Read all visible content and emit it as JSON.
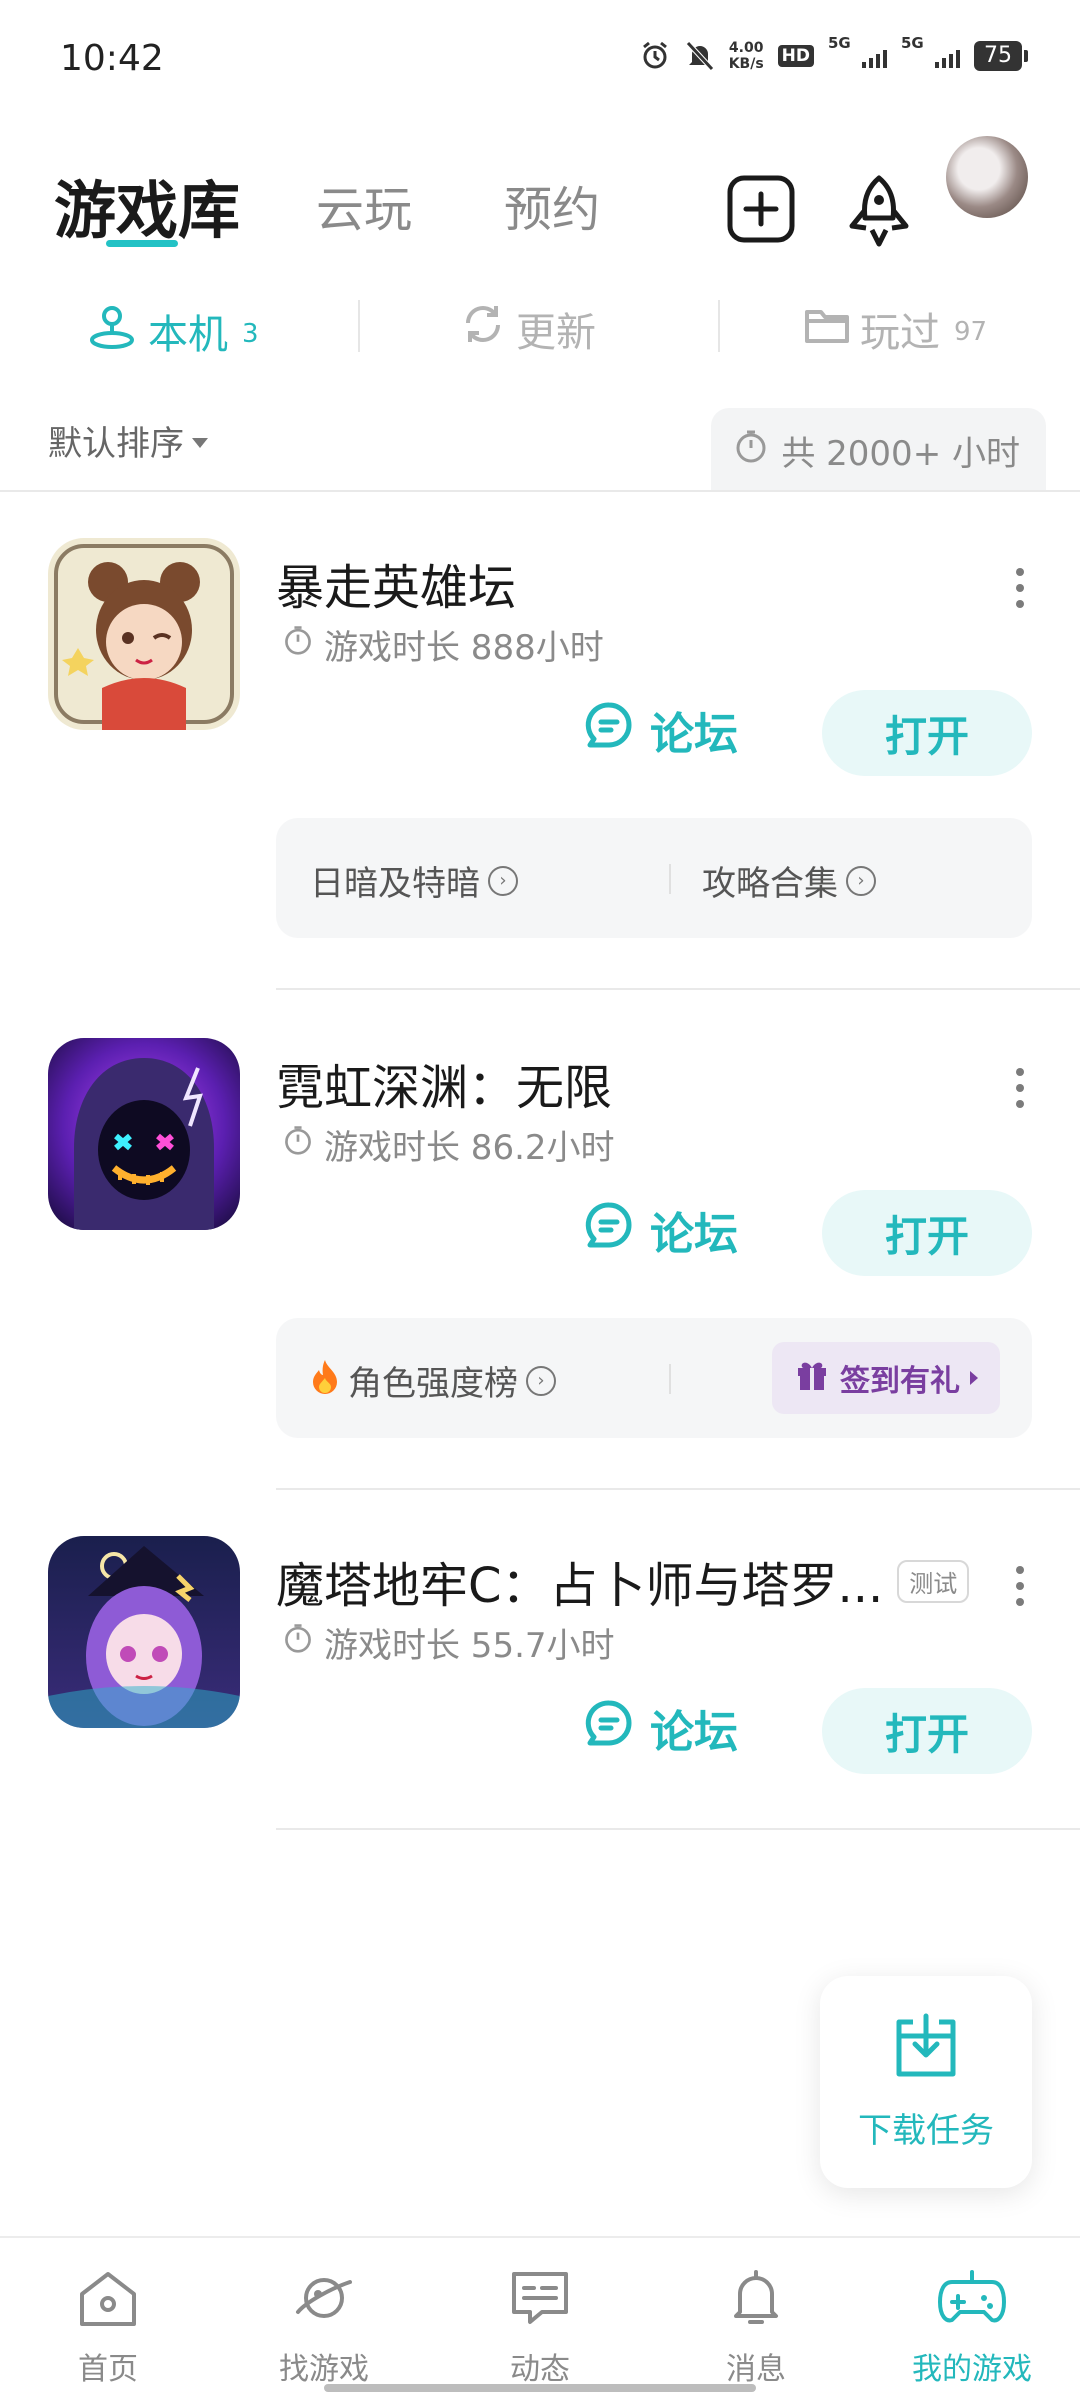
{
  "status_bar": {
    "time": "10:42",
    "net_speed_value": "4.00",
    "net_speed_unit": "KB/s",
    "hd": "HD",
    "sim1": "5G",
    "sim2": "5G",
    "battery": "75"
  },
  "top_nav": {
    "tabs": [
      {
        "label": "游戏库",
        "active": true
      },
      {
        "label": "云玩",
        "active": false
      },
      {
        "label": "预约",
        "active": false
      }
    ],
    "accent_color": "#23c2c5"
  },
  "sub_tabs": {
    "local": {
      "label": "本机",
      "count": "3"
    },
    "update": {
      "label": "更新"
    },
    "played": {
      "label": "玩过",
      "count": "97"
    }
  },
  "sort": {
    "label": "默认排序"
  },
  "total_time": "共 2000+ 小时",
  "games": [
    {
      "title": "暴走英雄坛",
      "play_time": "游戏时长 888小时",
      "forum_label": "论坛",
      "open_label": "打开",
      "links": [
        "日暗及特暗",
        "攻略合集"
      ]
    },
    {
      "title": "霓虹深渊：无限",
      "play_time": "游戏时长 86.2小时",
      "forum_label": "论坛",
      "open_label": "打开",
      "links": [
        "角色强度榜"
      ],
      "sign_in": "签到有礼"
    },
    {
      "title": "魔塔地牢C：占卜师与塔罗...",
      "tag": "测试",
      "play_time": "游戏时长 55.7小时",
      "forum_label": "论坛",
      "open_label": "打开"
    }
  ],
  "download_task": {
    "label": "下载任务"
  },
  "bottom_nav": [
    {
      "label": "首页",
      "icon": "home-icon"
    },
    {
      "label": "找游戏",
      "icon": "planet-icon"
    },
    {
      "label": "动态",
      "icon": "chat-icon"
    },
    {
      "label": "消息",
      "icon": "bell-icon"
    },
    {
      "label": "我的游戏",
      "icon": "gamepad-icon",
      "active": true
    }
  ]
}
